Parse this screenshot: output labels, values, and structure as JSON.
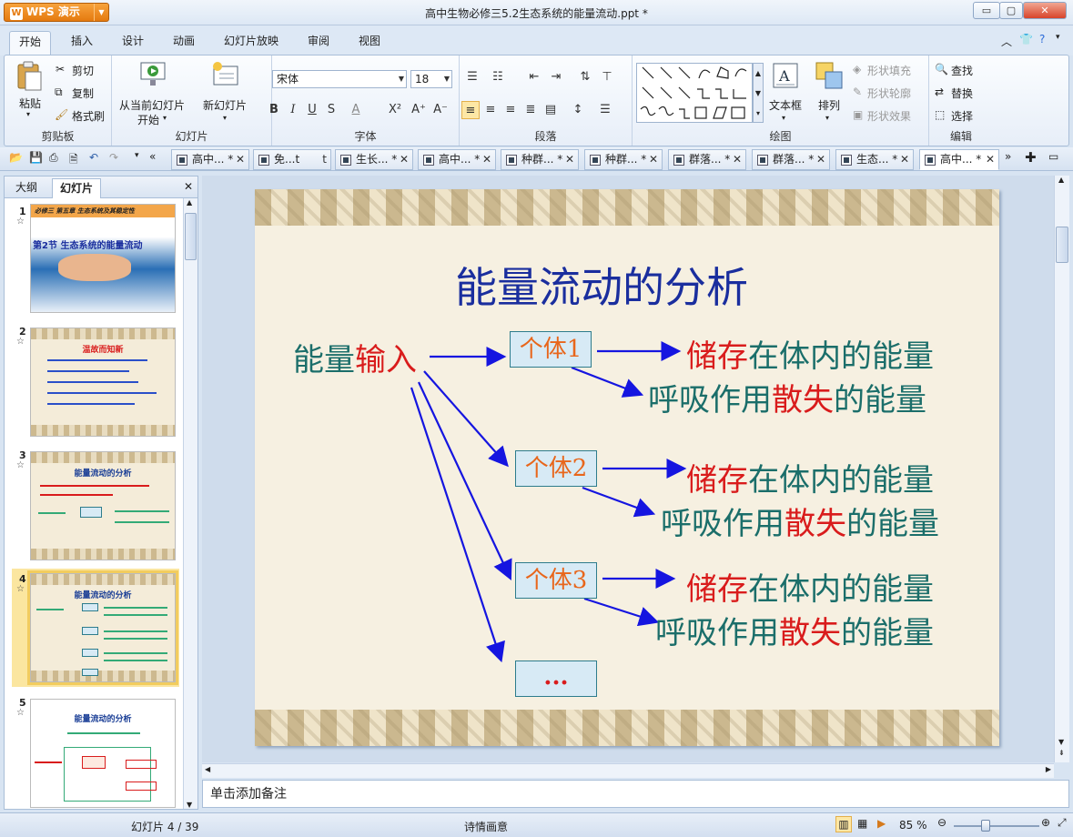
{
  "window": {
    "app_name": "WPS 演示",
    "title": "高中生物必修三5.2生态系统的能量流动.ppt *"
  },
  "ribbon_tabs": [
    "开始",
    "插入",
    "设计",
    "动画",
    "幻灯片放映",
    "审阅",
    "视图"
  ],
  "ribbon": {
    "clipboard": {
      "paste": "粘贴",
      "cut": "剪切",
      "copy": "复制",
      "format_painter": "格式刷",
      "label": "剪贴板"
    },
    "slides": {
      "from_current_1": "从当前幻灯片",
      "from_current_2": "开始",
      "new_slide": "新幻灯片",
      "label": "幻灯片"
    },
    "font": {
      "name": "宋体",
      "size": "18",
      "bold": "B",
      "italic": "I",
      "underline": "U",
      "strike": "S",
      "label": "字体"
    },
    "paragraph": {
      "label": "段落"
    },
    "drawing": {
      "textbox": "文本框",
      "arrange": "排列",
      "shape_fill": "形状填充",
      "shape_outline": "形状轮廓",
      "shape_effect": "形状效果",
      "label": "绘图"
    },
    "edit": {
      "find": "查找",
      "replace": "替换",
      "select": "选择",
      "label": "编辑"
    }
  },
  "doc_tabs": [
    "高中... *",
    "免...t",
    "生长... *",
    "高中... *",
    "种群... *",
    "种群... *",
    "群落... *",
    "群落... *",
    "生态... *",
    "高中... *"
  ],
  "panel_tabs": {
    "outline": "大纲",
    "slides": "幻灯片"
  },
  "thumbnails": [
    {
      "num": "1",
      "header": "必修三   第五章   生态系统及其稳定性",
      "title": "第2节 生态系统的能量流动"
    },
    {
      "num": "2",
      "title": "温故而知新"
    },
    {
      "num": "3",
      "title": "能量流动的分析"
    },
    {
      "num": "4",
      "title": "能量流动的分析"
    },
    {
      "num": "5",
      "title": "能量流动的分析"
    }
  ],
  "slide": {
    "title": "能量流动的分析",
    "input_a": "能量",
    "input_b": "输入",
    "boxes": [
      "个体1",
      "个体2",
      "个体3",
      "..."
    ],
    "stored_a": "储存",
    "stored_b": "在体内的能量",
    "lost_a": "呼吸作用",
    "lost_b": "散失",
    "lost_c": "的能量"
  },
  "notes_placeholder": "单击添加备注",
  "status": {
    "slide_pos": "幻灯片 4 / 39",
    "theme": "诗情画意",
    "zoom": "85 %"
  }
}
